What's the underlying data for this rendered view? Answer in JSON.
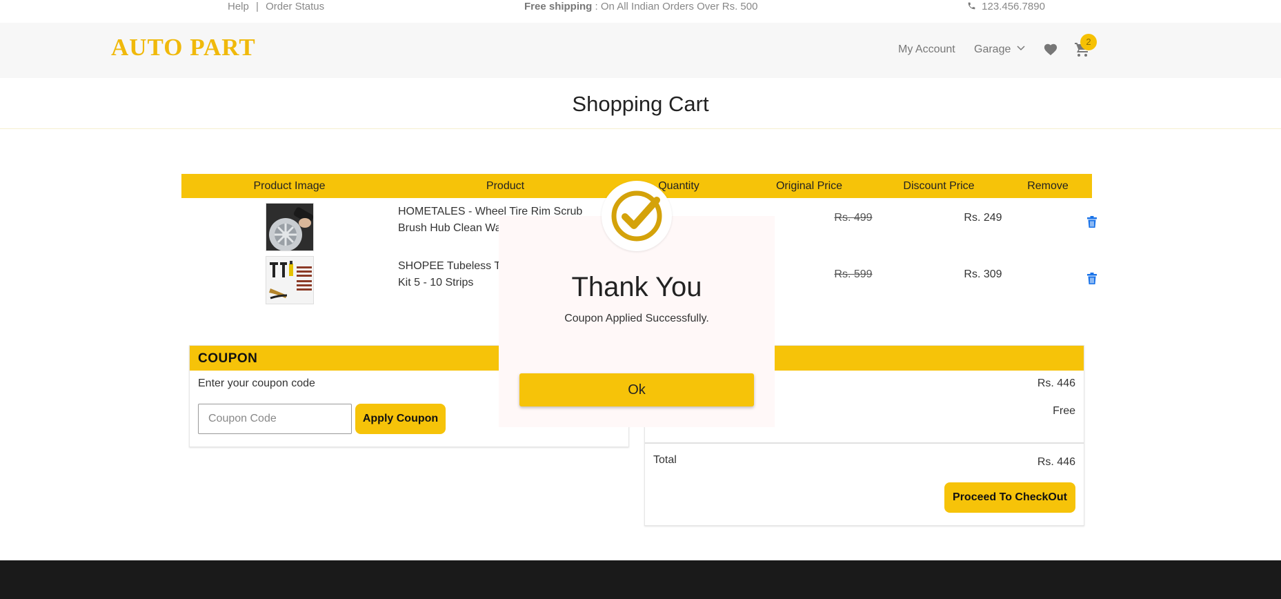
{
  "topbar": {
    "help": "Help",
    "separator": "|",
    "order_status": "Order Status",
    "shipping_bold": "Free shipping",
    "shipping_rest": ": On All Indian Orders Over Rs. 500",
    "phone": "123.456.7890",
    "phone_icon": "phone-icon"
  },
  "header": {
    "logo": "AUTO PART",
    "account": "My Account",
    "garage": "Garage",
    "garage_chevron": "⌄",
    "cart_count": "2",
    "icons": [
      "heart-icon",
      "cart-icon",
      "chevron-down-icon"
    ]
  },
  "page": {
    "title": "Shopping Cart"
  },
  "table": {
    "headers": [
      "Product Image",
      "Product",
      "Quantity",
      "Original Price",
      "Discount Price",
      "Remove"
    ],
    "rows": [
      {
        "name": "HOMETALES - Wheel Tire Rim Scrub Brush Hub Clean Wa",
        "original_price": "Rs. 499",
        "discount_price": "Rs. 249",
        "remove_icon": "trash-icon"
      },
      {
        "name": "SHOPEE Tubeless T Kit 5 - 10 Strips",
        "name_line1": "SHOPEE Tubeless T",
        "name_line2": "Kit 5 - 10 Strips",
        "original_price": "Rs. 599",
        "discount_price": "Rs. 309",
        "remove_icon": "trash-icon"
      }
    ]
  },
  "coupon": {
    "heading": "COUPON",
    "label": "Enter your coupon code",
    "placeholder": "Coupon Code",
    "apply": "Apply Coupon"
  },
  "summary": {
    "subtotal": "Rs. 446",
    "shipping": "Free",
    "total_label": "Total",
    "total": "Rs. 446",
    "checkout": "Proceed To CheckOut"
  },
  "modal": {
    "title": "Thank You",
    "message": "Coupon Applied Successfully.",
    "ok": "Ok",
    "icon": "check-circle-icon"
  },
  "colors": {
    "accent": "#f6c309",
    "logo": "#f0b90b",
    "trash": "#1a73e8",
    "footer": "#1a1a1a",
    "check": "#d4a20a"
  }
}
